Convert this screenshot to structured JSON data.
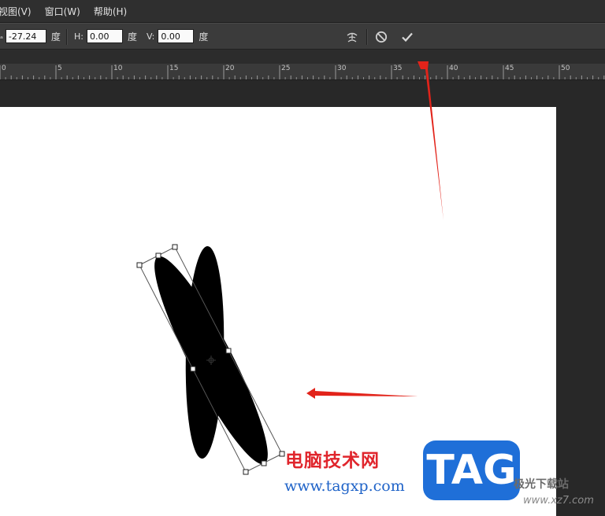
{
  "menu": {
    "items": [
      "视图(V)",
      "窗口(W)",
      "帮助(H)"
    ]
  },
  "options": {
    "angle_value": "-27.24",
    "angle_unit": "度",
    "h_label": "H:",
    "h_value": "0.00",
    "h_unit": "度",
    "v_label": "V:",
    "v_value": "0.00",
    "v_unit": "度"
  },
  "ruler": {
    "labels": [
      "0",
      "5",
      "10",
      "15",
      "20",
      "25",
      "30",
      "35",
      "40",
      "45",
      "50"
    ]
  },
  "watermark": {
    "cn_text": "电脑技术网",
    "url_text": "www.tagxp.com",
    "logo_text": "TAG",
    "site_text": "极光下载站",
    "site_url": "www.xz7.com"
  },
  "colors": {
    "menubar_bg": "#2f2f2f",
    "optionsbar_bg": "#3b3b3b",
    "workspace_bg": "#282828",
    "canvas_bg": "#ffffff",
    "arrow_red": "#e2231a",
    "logo_blue": "#1f6fd8"
  },
  "icons": [
    "warp-icon",
    "cancel-icon",
    "commit-check-icon",
    "reference-point-icon"
  ]
}
